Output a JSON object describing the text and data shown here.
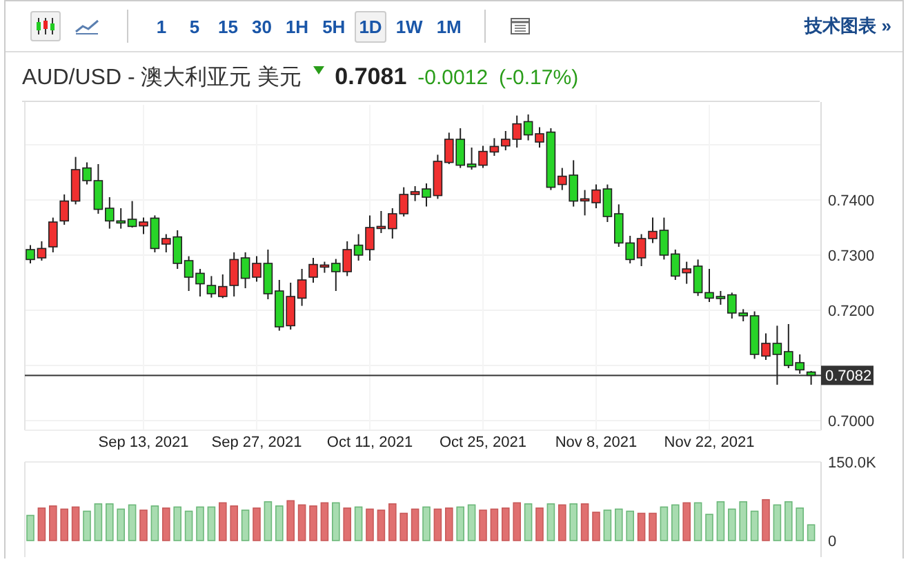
{
  "toolbar": {
    "chart_types": [
      {
        "kind": "candles",
        "selected": true
      },
      {
        "kind": "line",
        "selected": false
      }
    ],
    "intervals": [
      {
        "label": "1",
        "selected": false
      },
      {
        "label": "5",
        "selected": false
      },
      {
        "label": "15",
        "selected": false
      },
      {
        "label": "30",
        "selected": false
      },
      {
        "label": "1H",
        "selected": false
      },
      {
        "label": "5H",
        "selected": false
      },
      {
        "label": "1D",
        "selected": true
      },
      {
        "label": "1W",
        "selected": false
      },
      {
        "label": "1M",
        "selected": false
      }
    ],
    "link": "技术图表 »"
  },
  "quote": {
    "name": "AUD/USD - 澳大利亚元 美元",
    "falling": true,
    "price": "0.7081",
    "change": "-0.0012",
    "change_percent": "(-0.17%)"
  },
  "price_chart": {
    "chart_data": {
      "type": "candlestick",
      "grid": true,
      "ref_lines": [
        {
          "axis": "y",
          "value": 0.7082,
          "label": "0.7082"
        }
      ],
      "categories": [
        null,
        null,
        null,
        null,
        null,
        null,
        null,
        null,
        null,
        null,
        "Sep 13, 2021",
        null,
        null,
        null,
        null,
        null,
        null,
        null,
        null,
        null,
        "Sep 27, 2021",
        null,
        null,
        null,
        null,
        null,
        null,
        null,
        null,
        null,
        "Oct 11, 2021",
        null,
        null,
        null,
        null,
        null,
        null,
        null,
        null,
        null,
        "Oct 25, 2021",
        null,
        null,
        null,
        null,
        null,
        null,
        null,
        null,
        null,
        "Nov 8, 2021",
        null,
        null,
        null,
        null,
        null,
        null,
        null,
        null,
        null,
        "Nov 22, 2021",
        null,
        null,
        null,
        null,
        null,
        null,
        null,
        null,
        null
      ],
      "ohlc": [
        [
          0.731,
          0.7318,
          0.7285,
          0.7292
        ],
        [
          0.7295,
          0.7325,
          0.729,
          0.7312
        ],
        [
          0.7315,
          0.7368,
          0.7305,
          0.736
        ],
        [
          0.7362,
          0.741,
          0.7355,
          0.7398
        ],
        [
          0.7398,
          0.7478,
          0.7392,
          0.7455
        ],
        [
          0.7458,
          0.7468,
          0.7428,
          0.7435
        ],
        [
          0.7435,
          0.7465,
          0.7375,
          0.7383
        ],
        [
          0.7385,
          0.7405,
          0.7348,
          0.7362
        ],
        [
          0.7362,
          0.7385,
          0.7348,
          0.736
        ],
        [
          0.7365,
          0.7398,
          0.735,
          0.7352
        ],
        [
          0.7353,
          0.7368,
          0.7338,
          0.736
        ],
        [
          0.7367,
          0.7372,
          0.7305,
          0.7312
        ],
        [
          0.732,
          0.7338,
          0.7305,
          0.733
        ],
        [
          0.7333,
          0.7345,
          0.7275,
          0.7285
        ],
        [
          0.729,
          0.7298,
          0.7235,
          0.726
        ],
        [
          0.7267,
          0.7275,
          0.7225,
          0.7248
        ],
        [
          0.7245,
          0.7262,
          0.7223,
          0.723
        ],
        [
          0.7225,
          0.7265,
          0.7222,
          0.7243
        ],
        [
          0.7245,
          0.7305,
          0.7225,
          0.7292
        ],
        [
          0.7295,
          0.7305,
          0.724,
          0.7258
        ],
        [
          0.726,
          0.7298,
          0.7252,
          0.7285
        ],
        [
          0.7285,
          0.731,
          0.722,
          0.723
        ],
        [
          0.7235,
          0.7255,
          0.7163,
          0.717
        ],
        [
          0.7172,
          0.725,
          0.7165,
          0.7225
        ],
        [
          0.7222,
          0.7275,
          0.7208,
          0.7255
        ],
        [
          0.726,
          0.7295,
          0.725,
          0.7283
        ],
        [
          0.728,
          0.7288,
          0.7268,
          0.7282
        ],
        [
          0.7285,
          0.7293,
          0.7235,
          0.727
        ],
        [
          0.727,
          0.7325,
          0.7262,
          0.731
        ],
        [
          0.7318,
          0.7338,
          0.729,
          0.73
        ],
        [
          0.731,
          0.7372,
          0.729,
          0.735
        ],
        [
          0.735,
          0.738,
          0.734,
          0.7352
        ],
        [
          0.7348,
          0.7385,
          0.733,
          0.7375
        ],
        [
          0.7375,
          0.7423,
          0.737,
          0.741
        ],
        [
          0.741,
          0.7425,
          0.7398,
          0.7415
        ],
        [
          0.742,
          0.743,
          0.7388,
          0.7405
        ],
        [
          0.7408,
          0.7482,
          0.7402,
          0.747
        ],
        [
          0.7468,
          0.7522,
          0.7465,
          0.751
        ],
        [
          0.751,
          0.753,
          0.7458,
          0.7463
        ],
        [
          0.7465,
          0.7495,
          0.7455,
          0.746
        ],
        [
          0.7463,
          0.7498,
          0.7458,
          0.7488
        ],
        [
          0.7487,
          0.7512,
          0.748,
          0.7497
        ],
        [
          0.7498,
          0.7525,
          0.749,
          0.751
        ],
        [
          0.751,
          0.7553,
          0.7495,
          0.7538
        ],
        [
          0.7542,
          0.7555,
          0.7508,
          0.7518
        ],
        [
          0.7505,
          0.7532,
          0.7495,
          0.752
        ],
        [
          0.7523,
          0.753,
          0.7418,
          0.7423
        ],
        [
          0.7428,
          0.7458,
          0.7418,
          0.7443
        ],
        [
          0.7445,
          0.7472,
          0.7388,
          0.7398
        ],
        [
          0.74,
          0.7418,
          0.7372,
          0.7402
        ],
        [
          0.7395,
          0.7428,
          0.7385,
          0.7418
        ],
        [
          0.742,
          0.7428,
          0.736,
          0.737
        ],
        [
          0.7375,
          0.7392,
          0.7315,
          0.7322
        ],
        [
          0.7322,
          0.7335,
          0.7285,
          0.7292
        ],
        [
          0.7295,
          0.7338,
          0.728,
          0.733
        ],
        [
          0.733,
          0.7368,
          0.7322,
          0.7343
        ],
        [
          0.7345,
          0.7368,
          0.7292,
          0.73
        ],
        [
          0.7302,
          0.731,
          0.7255,
          0.7262
        ],
        [
          0.7268,
          0.7288,
          0.7248,
          0.7275
        ],
        [
          0.728,
          0.7292,
          0.7226,
          0.7232
        ],
        [
          0.7232,
          0.7275,
          0.7215,
          0.7222
        ],
        [
          0.7225,
          0.7235,
          0.721,
          0.7223
        ],
        [
          0.7228,
          0.7232,
          0.7185,
          0.7195
        ],
        [
          0.7195,
          0.7202,
          0.718,
          0.719
        ],
        [
          0.719,
          0.7198,
          0.7112,
          0.712
        ],
        [
          0.7117,
          0.7158,
          0.711,
          0.714
        ],
        [
          0.714,
          0.7172,
          0.7065,
          0.712
        ],
        [
          0.7125,
          0.7175,
          0.7095,
          0.71
        ],
        [
          0.7105,
          0.712,
          0.7085,
          0.7092
        ],
        [
          0.7088,
          0.709,
          0.7065,
          0.7082
        ]
      ],
      "ylim": [
        0.69825,
        0.75775
      ],
      "yticks": [
        {
          "value": 0.74,
          "label": "0.7400"
        },
        {
          "value": 0.73,
          "label": "0.7300"
        },
        {
          "value": 0.72,
          "label": "0.7200"
        },
        {
          "value": 0.7,
          "label": "0.7000"
        }
      ]
    }
  },
  "volume_chart": {
    "chart_data": {
      "type": "bar",
      "categories": [
        null,
        null,
        null,
        null,
        null,
        null,
        null,
        null,
        null,
        null,
        null,
        null,
        null,
        null,
        null,
        null,
        null,
        null,
        null,
        null,
        null,
        null,
        null,
        null,
        null,
        null,
        null,
        null,
        null,
        null,
        null,
        null,
        null,
        null,
        null,
        null,
        null,
        null,
        null,
        null,
        null,
        null,
        null,
        null,
        null,
        null,
        null,
        null,
        null,
        null,
        null,
        null,
        null,
        null,
        null,
        null,
        null,
        null,
        null,
        null,
        null,
        null,
        null,
        null,
        null,
        null,
        null,
        null,
        null,
        null
      ],
      "values": [
        48,
        62,
        66,
        60,
        64,
        56,
        70,
        70,
        60,
        68,
        58,
        66,
        62,
        64,
        56,
        64,
        64,
        72,
        66,
        58,
        62,
        74,
        66,
        76,
        68,
        66,
        72,
        72,
        62,
        64,
        60,
        58,
        70,
        52,
        60,
        64,
        60,
        62,
        64,
        68,
        58,
        60,
        62,
        72,
        70,
        62,
        70,
        68,
        70,
        70,
        54,
        58,
        60,
        56,
        52,
        52,
        64,
        68,
        72,
        72,
        50,
        74,
        60,
        74,
        56,
        78,
        68,
        74,
        62,
        30
      ],
      "ylim": [
        0,
        150
      ],
      "yticks": [
        {
          "value": 150,
          "label": "150.0K"
        },
        {
          "value": 0,
          "label": "0"
        }
      ]
    }
  }
}
